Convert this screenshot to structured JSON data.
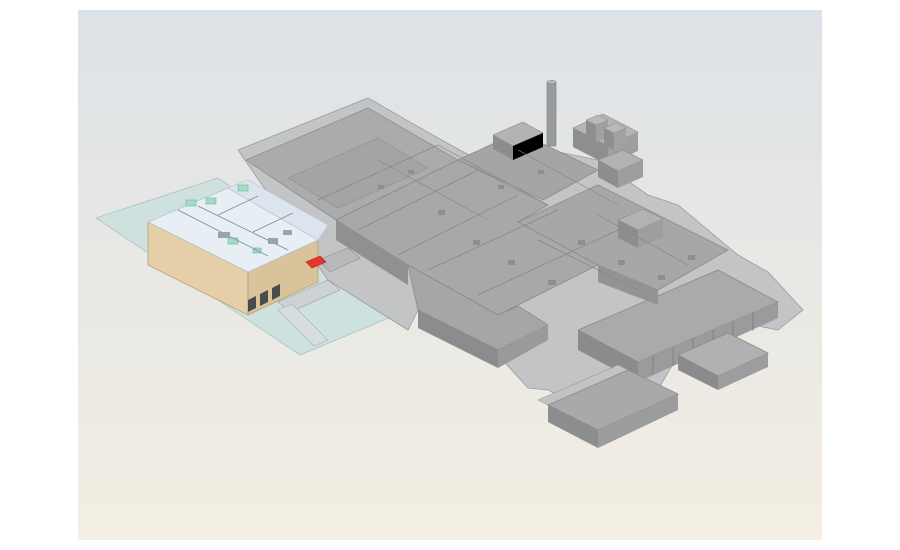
{
  "scene": {
    "subject": "isometric-facility-model",
    "colors": {
      "background_top": "#dfe3e6",
      "background_bottom": "#f3ede2",
      "building_roof": "#a9aaac",
      "building_side": "#8e8f91",
      "building_dark": "#6f7072",
      "ground_slab": "#c9cacc",
      "new_building_roof": "#e6eef4",
      "new_building_wall": "#e6d3b0",
      "site_pad": "#cfe0df",
      "ductwork": "#9fd8c2",
      "highlight": "#e8352b"
    }
  }
}
